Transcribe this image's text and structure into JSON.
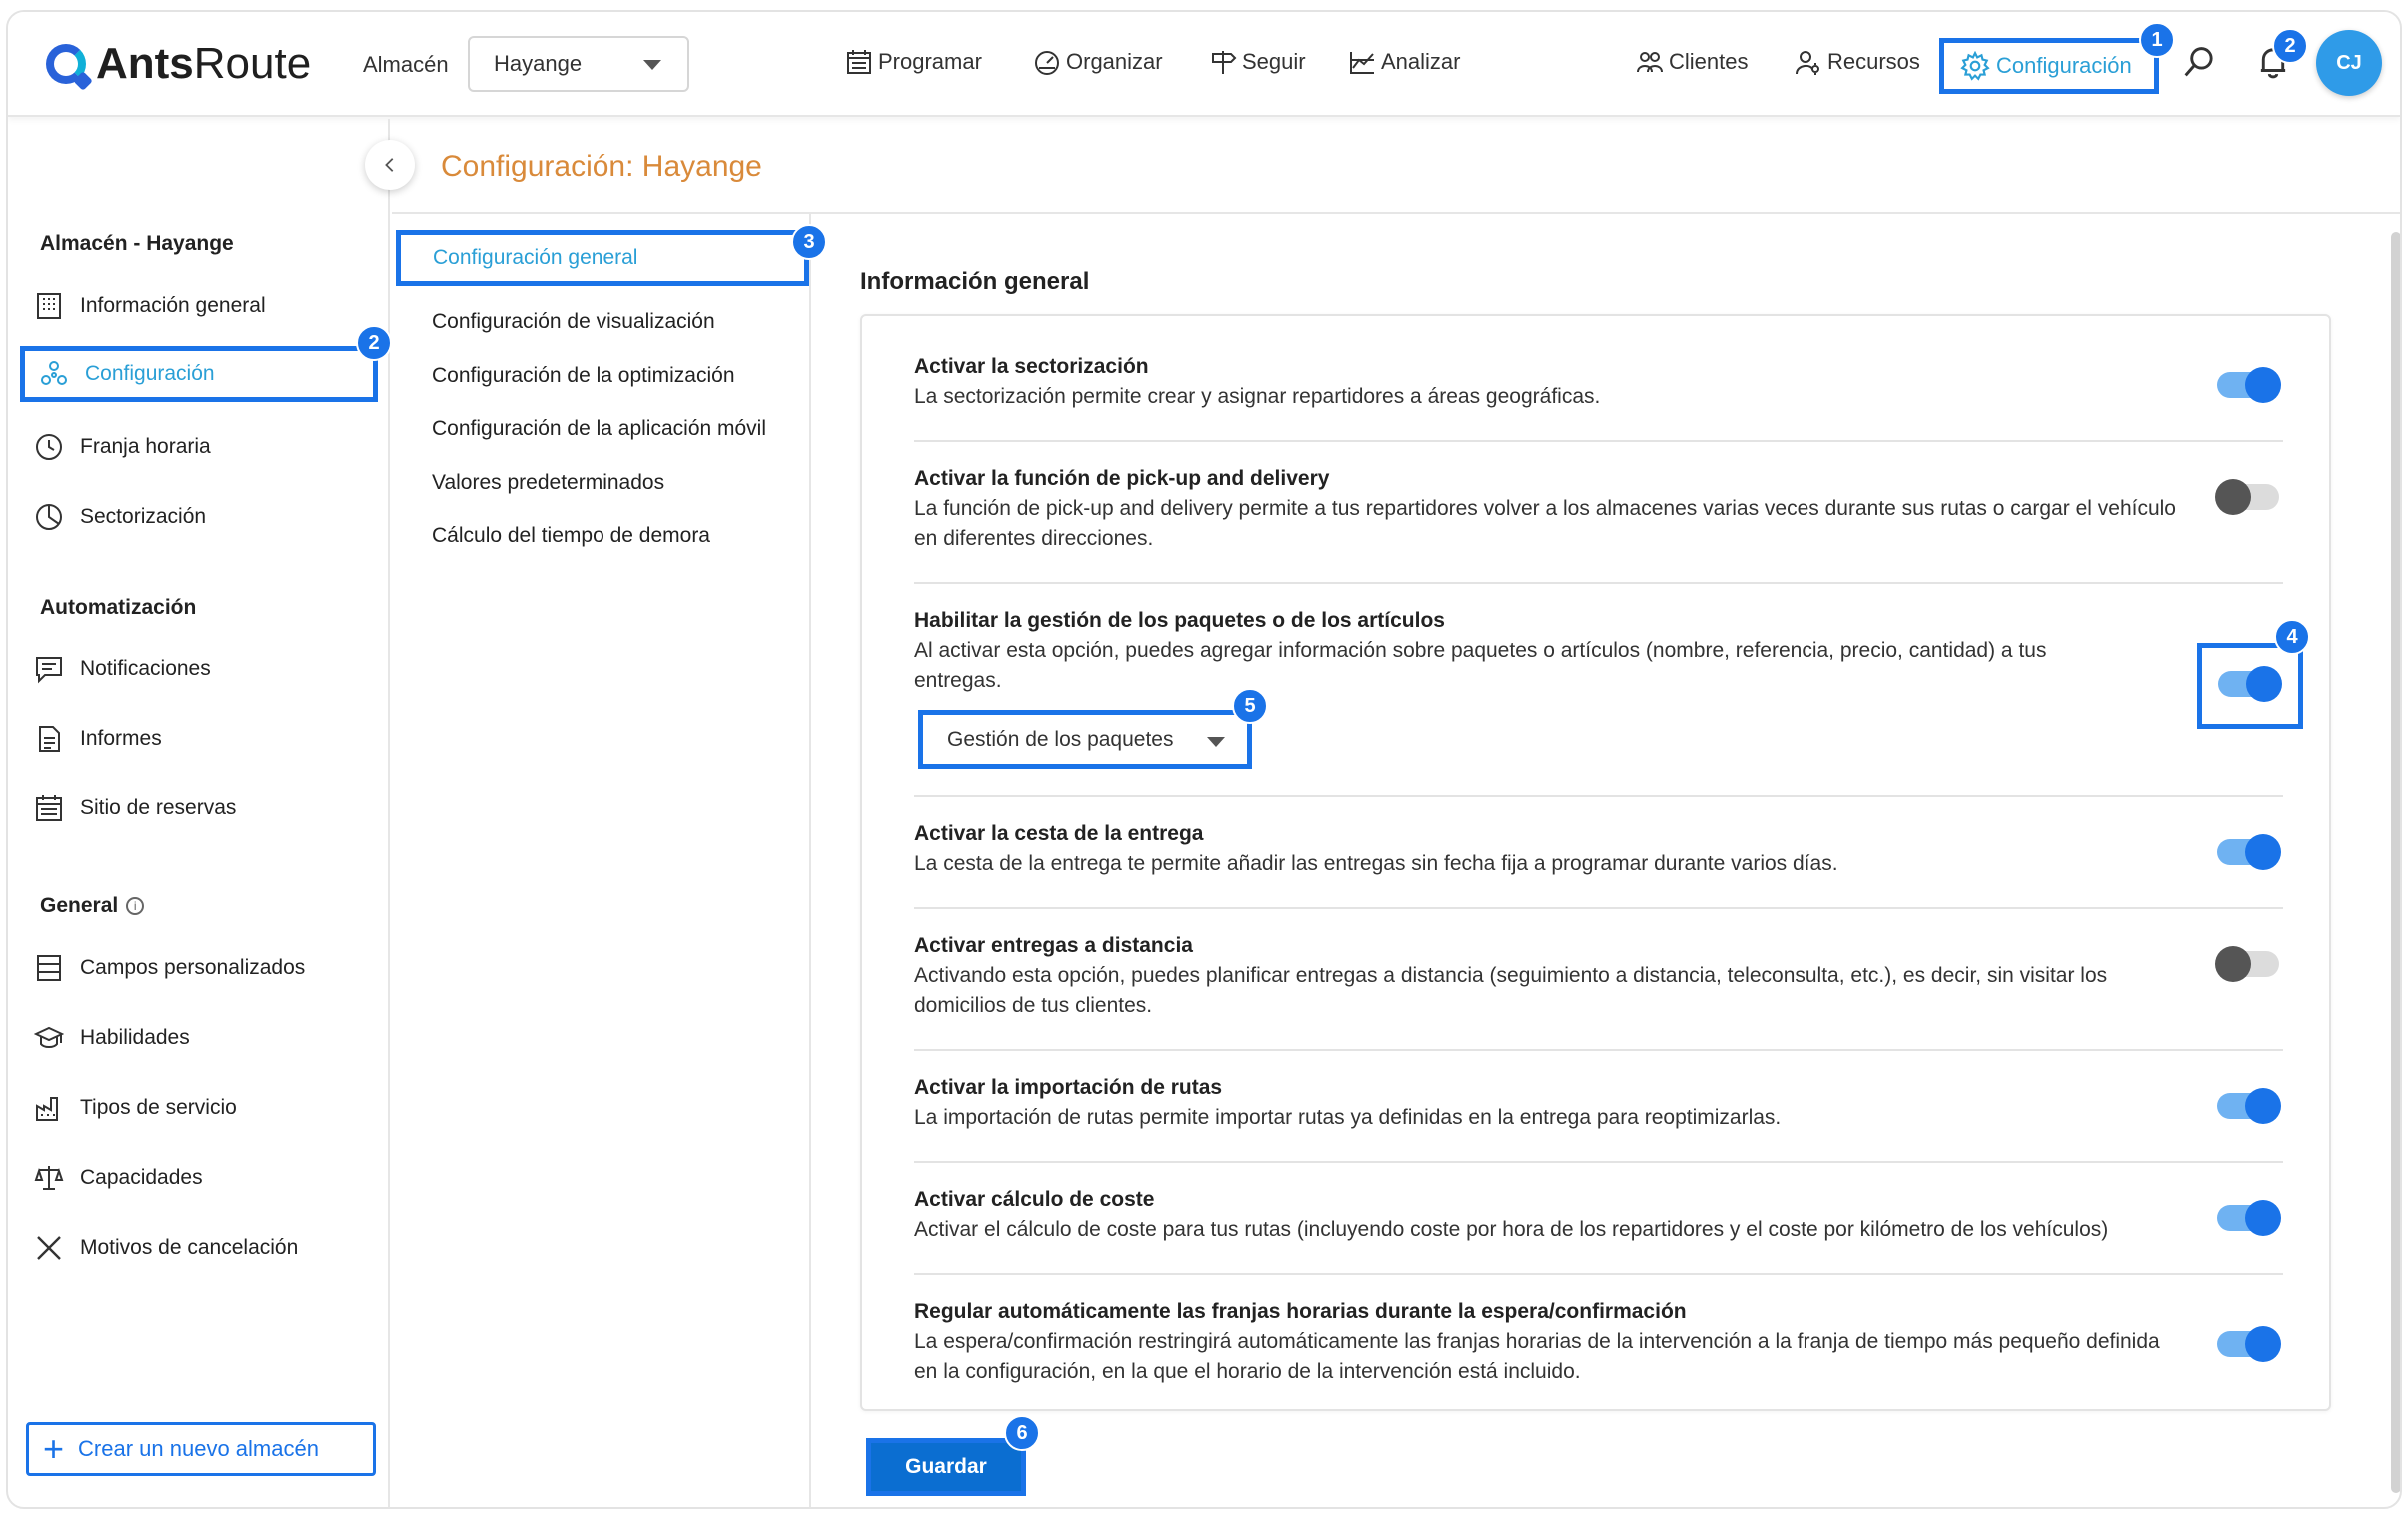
{
  "header": {
    "logo_text_1": "Ants",
    "logo_text_2": "Route",
    "warehouse_label": "Almacén",
    "warehouse_value": "Hayange",
    "nav": [
      {
        "label": "Programar",
        "icon": "calendar-icon"
      },
      {
        "label": "Organizar",
        "icon": "speedometer-icon"
      },
      {
        "label": "Seguir",
        "icon": "signpost-icon"
      },
      {
        "label": "Analizar",
        "icon": "chart-icon"
      }
    ],
    "right_nav": [
      {
        "label": "Clientes",
        "icon": "users-icon"
      },
      {
        "label": "Recursos",
        "icon": "user-gear-icon"
      },
      {
        "label": "Configuración",
        "icon": "gear-icon"
      }
    ],
    "notification_count": "2",
    "avatar_initials": "CJ"
  },
  "badges": [
    "1",
    "2",
    "3",
    "4",
    "5",
    "6"
  ],
  "sidebar": {
    "section1_title": "Almacén - Hayange",
    "section1_items": [
      {
        "label": "Información general",
        "icon": "building-icon"
      },
      {
        "label": "Configuración",
        "icon": "nodes-icon"
      },
      {
        "label": "Franja horaria",
        "icon": "clock-icon"
      },
      {
        "label": "Sectorización",
        "icon": "pie-icon"
      }
    ],
    "section2_title": "Automatización",
    "section2_items": [
      {
        "label": "Notificaciones",
        "icon": "message-icon"
      },
      {
        "label": "Informes",
        "icon": "document-icon"
      },
      {
        "label": "Sitio de reservas",
        "icon": "calendar-grid-icon"
      }
    ],
    "section3_title": "General",
    "section3_items": [
      {
        "label": "Campos personalizados",
        "icon": "list-icon"
      },
      {
        "label": "Habilidades",
        "icon": "graduation-cap-icon"
      },
      {
        "label": "Tipos de servicio",
        "icon": "factory-icon"
      },
      {
        "label": "Capacidades",
        "icon": "scale-icon"
      },
      {
        "label": "Motivos de cancelación",
        "icon": "x-icon"
      }
    ],
    "new_warehouse_label": "Crear un nuevo almacén"
  },
  "page_title": "Configuración: Hayange",
  "submenu": [
    "Configuración general",
    "Configuración de visualización",
    "Configuración de la optimización",
    "Configuración de la aplicación móvil",
    "Valores predeterminados",
    "Cálculo del tiempo de demora"
  ],
  "main": {
    "section_title": "Información general",
    "settings": [
      {
        "title": "Activar la sectorización",
        "desc": "La sectorización permite crear y asignar repartidores a áreas geográficas.",
        "enabled": true
      },
      {
        "title": "Activar la función de pick-up and delivery",
        "desc": "La función de pick-up and delivery permite a tus repartidores volver a los almacenes varias veces durante sus rutas o cargar el vehículo en diferentes direcciones.",
        "enabled": false
      },
      {
        "title": "Habilitar la gestión de los paquetes o de los artículos",
        "desc": "Al activar esta opción, puedes agregar información sobre paquetes o artículos (nombre, referencia, precio, cantidad) a tus entregas.",
        "enabled": true,
        "select_value": "Gestión de los paquetes"
      },
      {
        "title": "Activar la cesta de la entrega",
        "desc": "La cesta de la entrega te permite añadir las entregas sin fecha fija a programar durante varios días.",
        "enabled": true
      },
      {
        "title": "Activar entregas a distancia",
        "desc": "Activando esta opción, puedes planificar entregas a distancia (seguimiento a distancia, teleconsulta, etc.), es decir, sin visitar los domicilios de tus clientes.",
        "enabled": false
      },
      {
        "title": "Activar la importación de rutas",
        "desc": "La importación de rutas permite importar rutas ya definidas en la entrega para reoptimizarlas.",
        "enabled": true
      },
      {
        "title": "Activar cálculo de coste",
        "desc": "Activar el cálculo de coste para tus rutas (incluyendo coste por hora de los repartidores y el coste por kilómetro de los vehículos)",
        "enabled": true
      },
      {
        "title": "Regular automáticamente las franjas horarias durante la espera/confirmación",
        "desc": "La espera/confirmación restringirá automáticamente las franjas horarias de la intervención a la franja de tiempo más pequeño definida en la configuración, en la que el horario de la intervención está incluido.",
        "enabled": true
      }
    ],
    "save_label": "Guardar"
  },
  "colors": {
    "accent": "#1a73e8",
    "active_text": "#2a9fd6",
    "title_orange": "#d98a3a",
    "toggle_on": "#1a73e8",
    "toggle_off": "#555555"
  }
}
